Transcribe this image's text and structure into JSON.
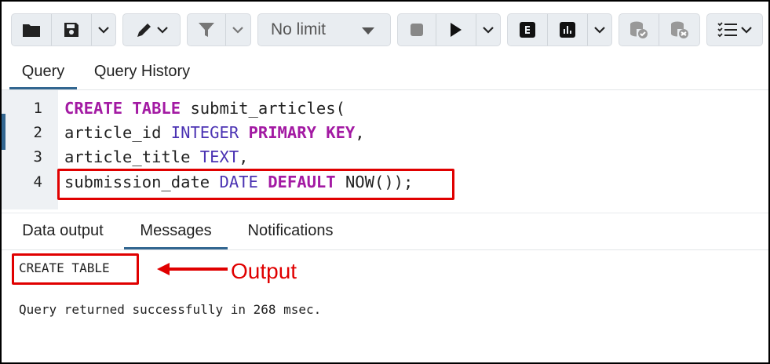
{
  "toolbar": {
    "limit_value": "No limit",
    "icons": [
      "folder-icon",
      "save-icon",
      "chevron-down-icon",
      "pen-icon",
      "chevron-down-icon",
      "filter-icon",
      "chevron-down-icon",
      "caret-down-icon",
      "stop-icon",
      "play-icon",
      "chevron-down-icon",
      "explain-icon",
      "explain-analyze-icon",
      "chevron-down-icon",
      "commit-icon",
      "rollback-icon",
      "macros-icon",
      "chevron-down-icon"
    ]
  },
  "query_tabs": [
    "Query",
    "Query History"
  ],
  "editor": {
    "line_numbers": [
      "1",
      "2",
      "3",
      "4"
    ],
    "lines": [
      [
        {
          "t": "CREATE TABLE",
          "c": "kw"
        },
        {
          "t": " submit_articles(",
          "c": ""
        }
      ],
      [
        {
          "t": "article_id ",
          "c": ""
        },
        {
          "t": "INTEGER",
          "c": "ty"
        },
        {
          "t": " ",
          "c": ""
        },
        {
          "t": "PRIMARY KEY",
          "c": "kw"
        },
        {
          "t": ",",
          "c": ""
        }
      ],
      [
        {
          "t": "article_title ",
          "c": ""
        },
        {
          "t": "TEXT",
          "c": "ty"
        },
        {
          "t": ",",
          "c": ""
        }
      ],
      [
        {
          "t": "submission_date ",
          "c": ""
        },
        {
          "t": "DATE",
          "c": "ty"
        },
        {
          "t": " ",
          "c": ""
        },
        {
          "t": "DEFAULT",
          "c": "kw"
        },
        {
          "t": " NOW());",
          "c": ""
        }
      ]
    ]
  },
  "output_tabs": [
    "Data output",
    "Messages",
    "Notifications"
  ],
  "messages": {
    "result": "CREATE TABLE",
    "status": "Query returned successfully in 268 msec."
  },
  "annotation": {
    "label": "Output",
    "color": "#e00000"
  }
}
